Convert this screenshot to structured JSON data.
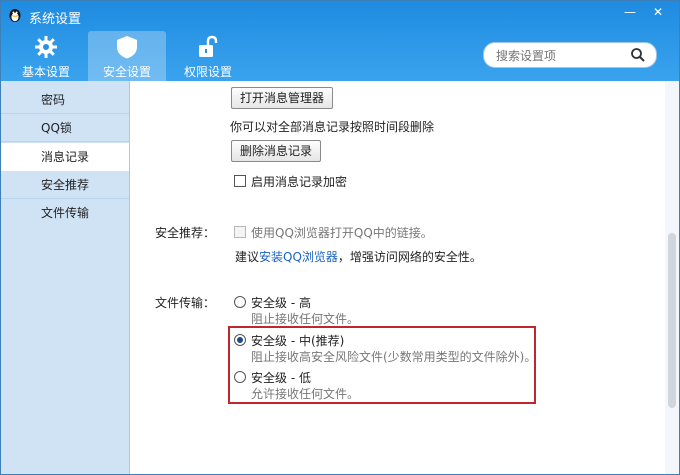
{
  "window": {
    "title": "系统设置",
    "min_symbol": "—",
    "close_symbol": "✕"
  },
  "toolbar": {
    "tabs": [
      {
        "label": "基本设置",
        "icon": "gear-icon"
      },
      {
        "label": "安全设置",
        "icon": "shield-icon",
        "active": true
      },
      {
        "label": "权限设置",
        "icon": "lock-icon"
      }
    ]
  },
  "search": {
    "placeholder": "搜索设置项",
    "icon": "search-icon"
  },
  "sidebar": {
    "items": [
      {
        "label": "密码"
      },
      {
        "label": "QQ锁"
      },
      {
        "label": "消息记录",
        "active": true
      },
      {
        "label": "安全推荐"
      },
      {
        "label": "文件传输"
      }
    ]
  },
  "message_record": {
    "open_manager_button": "打开消息管理器",
    "delete_hint": "你可以对全部消息记录按照时间段删除",
    "delete_button": "删除消息记录",
    "encrypt_label": "启用消息记录加密"
  },
  "security_recommend": {
    "label": "安全推荐：",
    "browser_checkbox_label": "使用QQ浏览器打开QQ中的链接。",
    "suggest_prefix": "建议",
    "suggest_link": "安装QQ浏览器",
    "suggest_suffix": "，增强访问网络的安全性。"
  },
  "file_transfer": {
    "label": "文件传输：",
    "options": [
      {
        "title": "安全级 - 高",
        "desc": "阻止接收任何文件。",
        "checked": false
      },
      {
        "title": "安全级 - 中(推荐)",
        "desc": "阻止接收高安全风险文件(少数常用类型的文件除外)。",
        "checked": true
      },
      {
        "title": "安全级 - 低",
        "desc": "允许接收任何文件。",
        "checked": false
      }
    ]
  },
  "colors": {
    "header": "#2a95e6",
    "sidebar": "#cfe3f5",
    "highlight": "#c0272d",
    "link": "#1a63c2"
  }
}
